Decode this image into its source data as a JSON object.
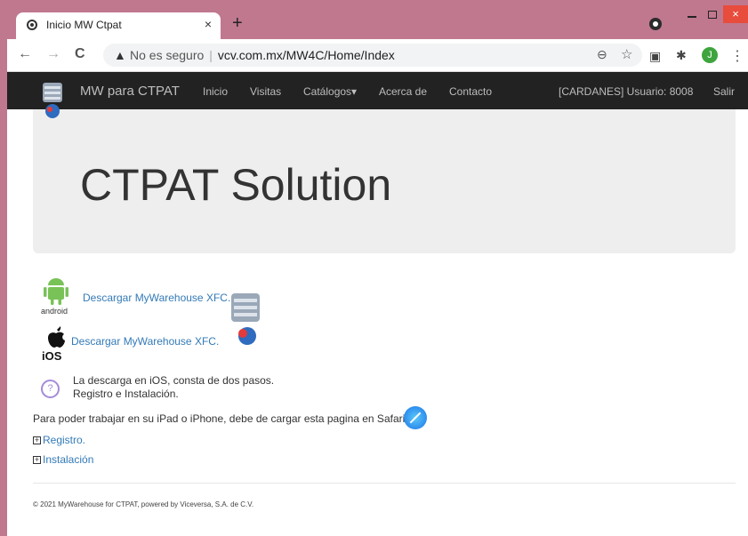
{
  "browser": {
    "tab_title": "Inicio MW Ctpat",
    "tab_close": "×",
    "new_tab": "+",
    "back": "←",
    "forward": "→",
    "reload": "C",
    "security_label": "No es seguro",
    "url": "vcv.com.mx/MW4C/Home/Index",
    "profile_initial": "J",
    "close": "×"
  },
  "navbar": {
    "brand": "MW para CTPAT",
    "links": [
      "Inicio",
      "Visitas",
      "Catálogos▾",
      "Acerca de",
      "Contacto"
    ],
    "user_info": "[CARDANES] Usuario: 8008",
    "logout": "Salir"
  },
  "jumbotron": {
    "title": "CTPAT Solution"
  },
  "downloads": {
    "android_label": "Descargar MyWarehouse XFC.",
    "android_text": "android",
    "ios_label": "Descargar MyWarehouse XFC.",
    "ios_text": "iOS"
  },
  "info": {
    "line1": "La descarga en iOS, consta de dos pasos.",
    "line2": "Registro e Instalación.",
    "safari_note": "Para poder trabajar en su iPad o iPhone, debe de cargar esta pagina en Safari."
  },
  "steps": {
    "expand_symbol": "+",
    "registro": "Registro.",
    "instalacion": "Instalación"
  },
  "footer": {
    "text": "© 2021 MyWarehouse for CTPAT, powered by Viceversa, S.A. de C.V."
  },
  "colors": {
    "accent_link": "#337ab7",
    "navbar_bg": "#222222",
    "frame": "#c0788f"
  }
}
